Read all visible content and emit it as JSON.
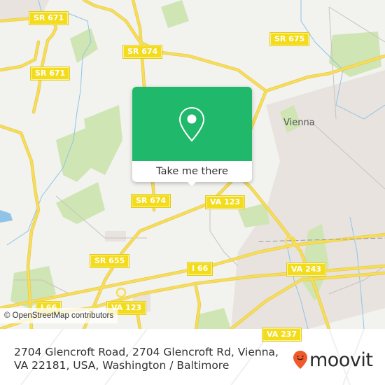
{
  "map": {
    "attribution": "© OpenStreetMap contributors",
    "place_labels": [
      {
        "id": "vienna",
        "text": "Vienna"
      }
    ],
    "road_shields": [
      {
        "id": "sr-671-top",
        "text": "SR 671"
      },
      {
        "id": "sr-671-left",
        "text": "SR 671"
      },
      {
        "id": "sr-674-top",
        "text": "SR 674"
      },
      {
        "id": "sr-675",
        "text": "SR 675"
      },
      {
        "id": "sr-674-mid",
        "text": "SR 674"
      },
      {
        "id": "va-123-mid",
        "text": "VA 123"
      },
      {
        "id": "sr-655",
        "text": "SR 655"
      },
      {
        "id": "i-66-mid",
        "text": "I 66"
      },
      {
        "id": "va-243",
        "text": "VA 243"
      },
      {
        "id": "i-66-left",
        "text": "I 66"
      },
      {
        "id": "va-123-low",
        "text": "VA 123"
      },
      {
        "id": "va-237",
        "text": "VA 237"
      }
    ],
    "colors": {
      "background": "#f2f2ef",
      "road": "#f7de58",
      "park": "#cfe5b4",
      "urban": "#e4ddd8",
      "water": "#8fc4e8"
    }
  },
  "popup": {
    "icon": "map-pin-icon",
    "cta_label": "Take me there",
    "accent_color": "#20b86a"
  },
  "footer": {
    "address": "2704 Glencroft Road, 2704 Glencroft Rd, Vienna, VA 22181, USA, Washington / Baltimore",
    "logo_text": "moovit",
    "logo_icon": "moovit-pin-smile-icon",
    "logo_color": "#f0592a"
  }
}
